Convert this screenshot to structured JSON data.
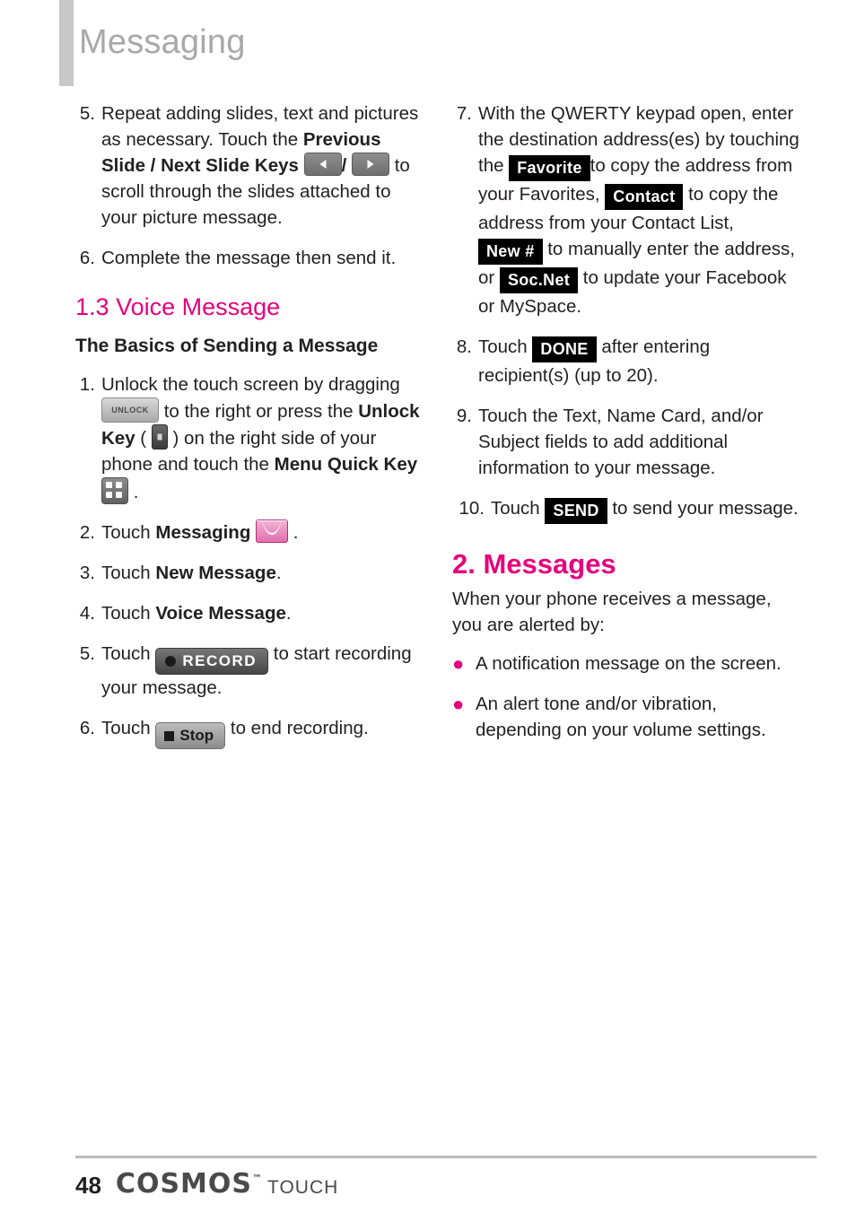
{
  "header": {
    "title": "Messaging"
  },
  "left_column": {
    "step5": {
      "num": "5.",
      "t1": "Repeat adding slides, text and pictures as necessary. Touch the ",
      "bold1": "Previous Slide / Next Slide Keys",
      "slash": "/",
      "t2": " to scroll through the slides attached to your picture message.",
      "key_left": "previous-slide-key",
      "key_right": "next-slide-key"
    },
    "step6": {
      "num": "6.",
      "text": "Complete the message then send it."
    },
    "section": {
      "number": "1.3",
      "title": "Voice Message"
    },
    "subhead": "The Basics of Sending a Message",
    "s1": {
      "num": "1.",
      "t1": "Unlock the touch screen by dragging ",
      "unlock_label": "UNLOCK",
      "t2": " to the right or press the ",
      "bold1": "Unlock Key",
      "t3": " ( ",
      "t4": " ) on the right side of your phone and touch the ",
      "bold2": "Menu Quick Key",
      "t5": " ."
    },
    "s2": {
      "num": "2.",
      "t1": "Touch ",
      "bold": "Messaging",
      "t2": " ."
    },
    "s3": {
      "num": "3.",
      "t1": "Touch ",
      "bold": "New Message",
      "t2": "."
    },
    "s4": {
      "num": "4.",
      "t1": "Touch ",
      "bold": "Voice Message",
      "t2": "."
    },
    "s5": {
      "num": "5.",
      "t1": "Touch ",
      "btn": "RECORD",
      "t2": " to start recording your message."
    },
    "s6": {
      "num": "6.",
      "t1": "Touch ",
      "btn": "Stop",
      "t2": " to end recording."
    }
  },
  "right_column": {
    "step7": {
      "num": "7.",
      "t1": "With the QWERTY keypad open, enter the destination address(es) by touching the ",
      "btn_favorite": "Favorite",
      "t2": "to copy the address from your Favorites, ",
      "btn_contact": "Contact",
      "t3": " to copy the address from your Contact List, ",
      "btn_new": "New #",
      "t4": " to manually enter the address, or ",
      "btn_socnet": "Soc.Net",
      "t5": " to update your Facebook or MySpace."
    },
    "step8": {
      "num": "8.",
      "t1": "Touch ",
      "btn": "DONE",
      "t2": " after entering recipient(s) (up to 20)."
    },
    "step9": {
      "num": "9.",
      "text": "Touch the Text, Name Card, and/or Subject fields to add additional information to your message."
    },
    "step10": {
      "num": "10.",
      "t1": "Touch ",
      "btn": "SEND",
      "t2": " to send your message."
    },
    "section2": {
      "title": "2. Messages",
      "intro": "When your phone receives a message, you are alerted by:",
      "bullets": [
        "A notification message on the screen.",
        "An alert tone and/or vibration, depending on your volume settings."
      ]
    }
  },
  "footer": {
    "page_number": "48",
    "brand": "COSMOS",
    "tm": "™",
    "touch": "TOUCH"
  },
  "colors": {
    "accent_pink": "#e5007d",
    "header_gray": "#a8a8a8",
    "rule_gray": "#bcbcbc"
  }
}
